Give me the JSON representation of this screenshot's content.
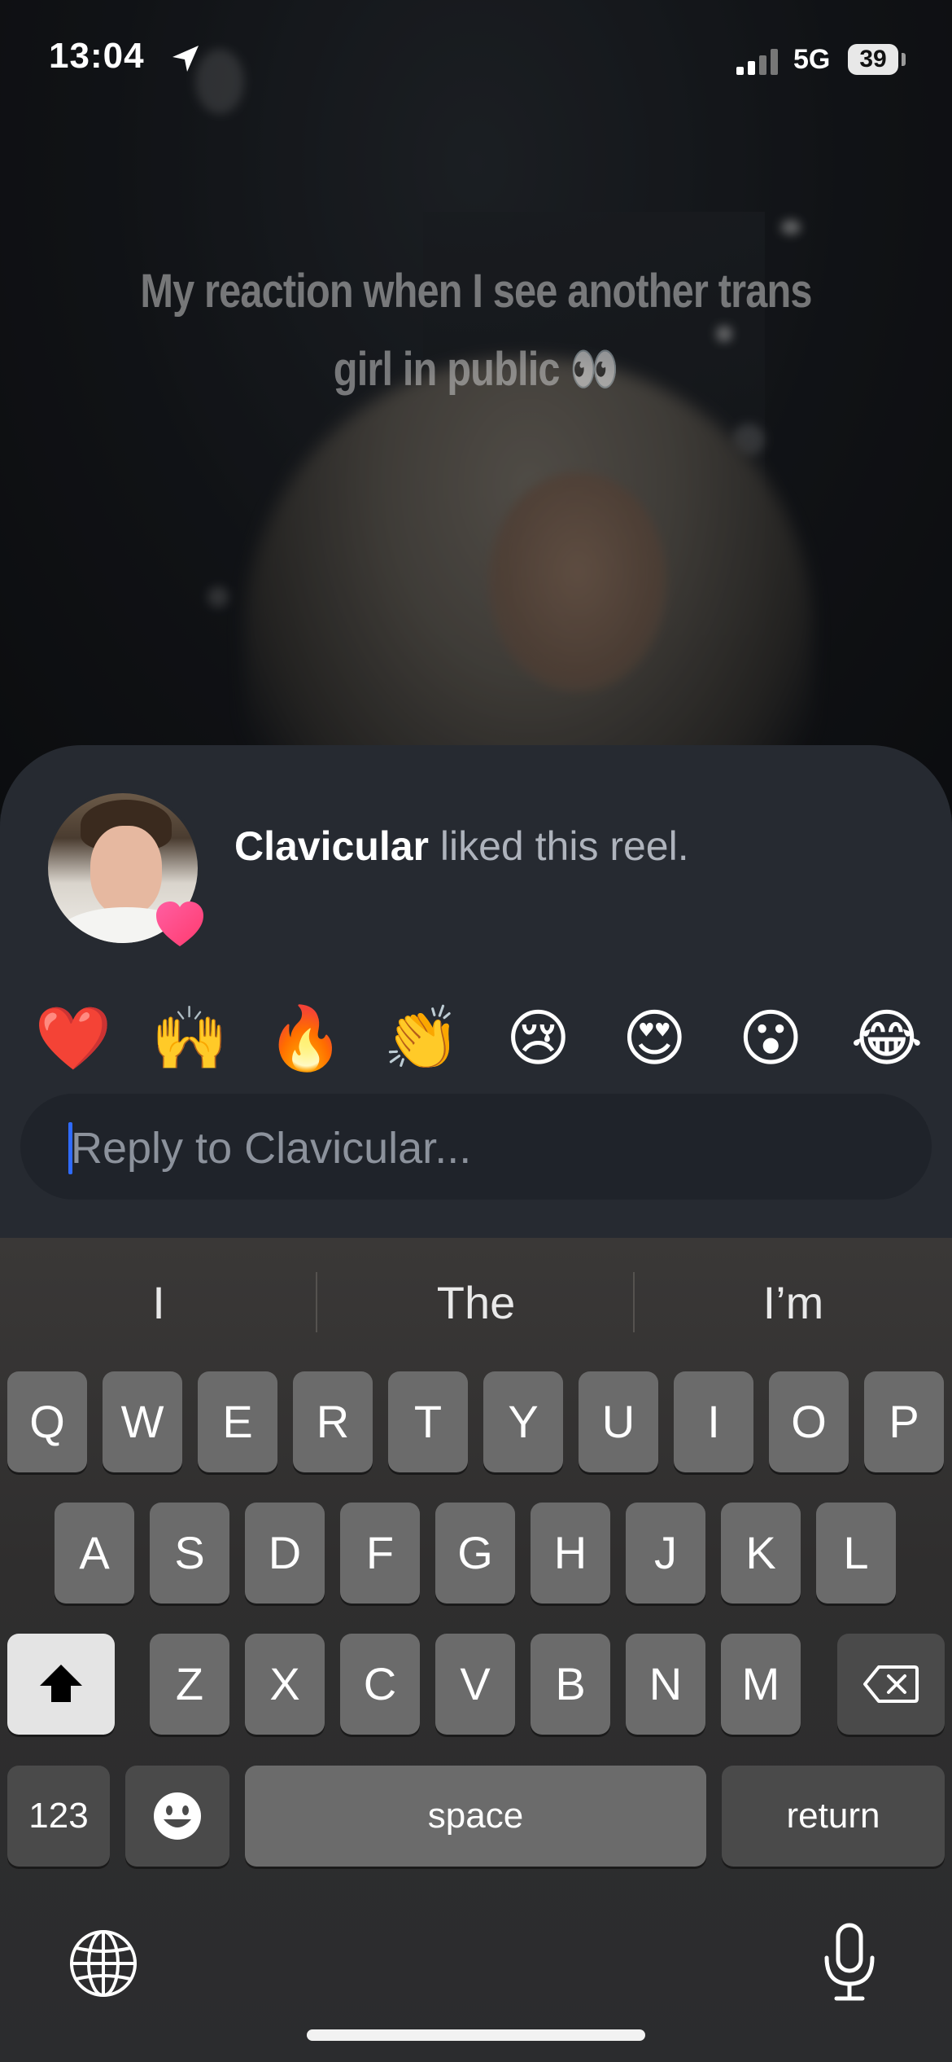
{
  "status_bar": {
    "time": "13:04",
    "network": "5G",
    "battery": "39"
  },
  "video": {
    "caption_line1": "My reaction when I see another trans",
    "caption_line2": "girl in public 👀"
  },
  "notification": {
    "username": "Clavicular",
    "action_text": " liked this reel."
  },
  "reactions": [
    "❤️",
    "🙌",
    "🔥",
    "👏",
    "😢",
    "😍",
    "😮",
    "😂"
  ],
  "reply": {
    "placeholder": "Reply to Clavicular..."
  },
  "keyboard": {
    "suggestions": [
      "I",
      "The",
      "I’m"
    ],
    "row1": [
      "Q",
      "W",
      "E",
      "R",
      "T",
      "Y",
      "U",
      "I",
      "O",
      "P"
    ],
    "row2": [
      "A",
      "S",
      "D",
      "F",
      "G",
      "H",
      "J",
      "K",
      "L"
    ],
    "row3": [
      "Z",
      "X",
      "C",
      "V",
      "B",
      "N",
      "M"
    ],
    "numbers_label": "123",
    "space_label": "space",
    "return_label": "return"
  },
  "icons": {
    "location": "location-arrow-icon",
    "signal": "cell-signal-icon",
    "heart_badge": "heart-icon",
    "shift": "shift-arrow-icon",
    "backspace": "backspace-icon",
    "emoji": "emoji-face-icon",
    "globe": "globe-icon",
    "mic": "microphone-icon"
  },
  "colors": {
    "sheet": "#262a31",
    "caret": "#2f6bff",
    "key": "#6b6b6b",
    "key_dark": "#4a4a4a"
  }
}
